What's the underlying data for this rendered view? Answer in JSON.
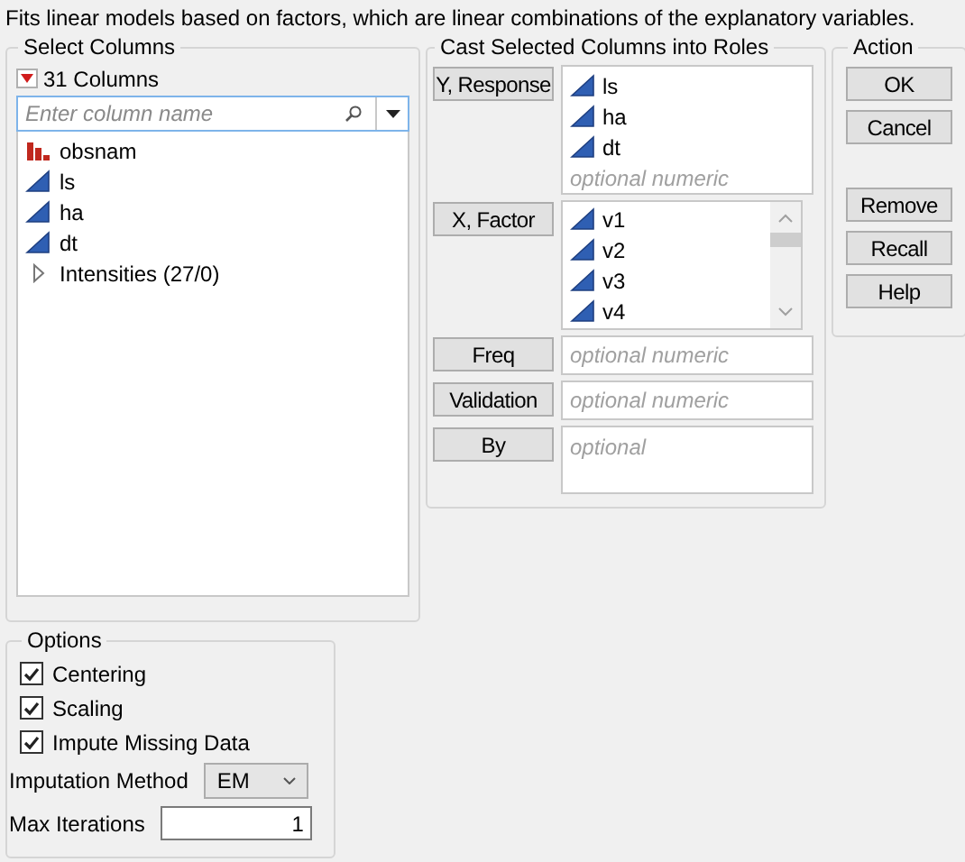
{
  "description": "Fits linear models based on factors, which are linear combinations of the explanatory variables.",
  "select_columns": {
    "title": "Select Columns",
    "count": "31 Columns",
    "search": {
      "placeholder": "Enter column name"
    },
    "columns": [
      {
        "name": "obsnam",
        "kind": "nominal"
      },
      {
        "name": "ls",
        "kind": "continuous"
      },
      {
        "name": "ha",
        "kind": "continuous"
      },
      {
        "name": "dt",
        "kind": "continuous"
      },
      {
        "name": "Intensities (27/0)",
        "kind": "group",
        "expanded": false
      }
    ]
  },
  "roles": {
    "title": "Cast Selected Columns into Roles",
    "items": [
      {
        "button": "Y, Response",
        "kind": "list",
        "columns": [
          "ls",
          "ha",
          "dt"
        ],
        "placeholder": "optional numeric"
      },
      {
        "button": "X, Factor",
        "kind": "scroll",
        "columns": [
          "v1",
          "v2",
          "v3",
          "v4"
        ]
      },
      {
        "button": "Freq",
        "kind": "field",
        "placeholder": "optional numeric"
      },
      {
        "button": "Validation",
        "kind": "field",
        "placeholder": "optional numeric"
      },
      {
        "button": "By",
        "kind": "tall",
        "placeholder": "optional"
      }
    ]
  },
  "action": {
    "title": "Action",
    "buttons": [
      "OK",
      "Cancel"
    ],
    "more_buttons": [
      "Remove",
      "Recall",
      "Help"
    ]
  },
  "options": {
    "title": "Options",
    "checkboxes": [
      {
        "label": "Centering",
        "checked": true
      },
      {
        "label": "Scaling",
        "checked": true
      },
      {
        "label": "Impute Missing Data",
        "checked": true
      }
    ],
    "imputation_method": {
      "label": "Imputation Method",
      "value": "EM"
    },
    "max_iterations": {
      "label": "Max Iterations",
      "value": "1"
    }
  }
}
